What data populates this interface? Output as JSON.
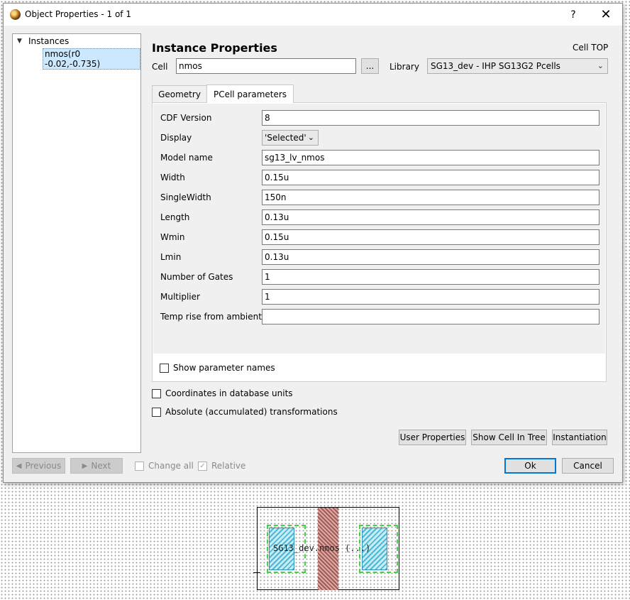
{
  "window": {
    "title": "Object Properties - 1 of 1",
    "help_symbol": "?",
    "close_symbol": "✕"
  },
  "tree": {
    "root_label": "Instances",
    "child_label": "nmos(r0 -0.02,-0.735)"
  },
  "header": {
    "title": "Instance Properties",
    "cell_top": "Cell TOP"
  },
  "cell": {
    "label": "Cell",
    "value": "nmos",
    "browse_label": "..."
  },
  "library": {
    "label": "Library",
    "value": "SG13_dev - IHP SG13G2 Pcells"
  },
  "tabs": [
    {
      "label": "Geometry"
    },
    {
      "label": "PCell parameters"
    }
  ],
  "params": [
    {
      "label": "CDF Version",
      "value": "8"
    },
    {
      "label": "Display",
      "value": "'Selected'"
    },
    {
      "label": "Model name",
      "value": "sg13_lv_nmos"
    },
    {
      "label": "Width",
      "value": "0.15u"
    },
    {
      "label": "SingleWidth",
      "value": "150n"
    },
    {
      "label": "Length",
      "value": "0.13u"
    },
    {
      "label": "Wmin",
      "value": "0.15u"
    },
    {
      "label": "Lmin",
      "value": "0.13u"
    },
    {
      "label": "Number of Gates",
      "value": "1"
    },
    {
      "label": "Multiplier",
      "value": "1"
    },
    {
      "label": "Temp rise from ambient",
      "value": ""
    }
  ],
  "options": {
    "show_param_names": "Show parameter names",
    "coords_db_units": "Coordinates in database units",
    "absolute_transform": "Absolute (accumulated) transformations"
  },
  "buttons": {
    "user_properties": "User Properties",
    "show_cell_in_tree": "Show Cell In Tree",
    "instantiation": "Instantiation",
    "previous": "Previous",
    "next": "Next",
    "ok": "Ok",
    "cancel": "Cancel"
  },
  "footer": {
    "change_all": "Change all",
    "relative": "Relative"
  },
  "layout": {
    "label": "SG13_dev.nmos (...)"
  }
}
